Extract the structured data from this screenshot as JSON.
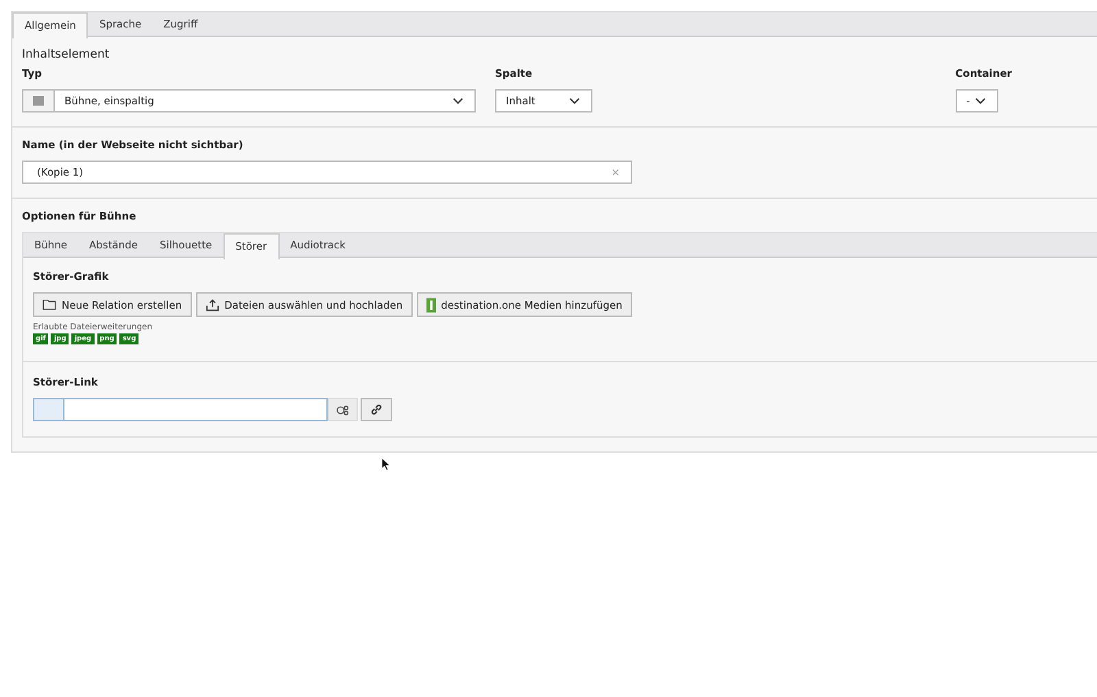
{
  "tabs": [
    {
      "label": "Allgemein",
      "selected": true
    },
    {
      "label": "Sprache",
      "selected": false
    },
    {
      "label": "Zugriff",
      "selected": false
    }
  ],
  "section_title": "Inhaltselement",
  "fields": {
    "typ": {
      "label": "Typ",
      "value": "Bühne, einspaltig"
    },
    "spalte": {
      "label": "Spalte",
      "value": "Inhalt"
    },
    "container": {
      "label": "Container",
      "value": "-"
    }
  },
  "name_field": {
    "label": "Name (in der Webseite nicht sichtbar)",
    "value": "(Kopie 1)",
    "clear": "×"
  },
  "options": {
    "title": "Optionen für Bühne",
    "tabs": [
      {
        "label": "Bühne",
        "selected": false
      },
      {
        "label": "Abstände",
        "selected": false
      },
      {
        "label": "Silhouette",
        "selected": false
      },
      {
        "label": "Störer",
        "selected": true
      },
      {
        "label": "Audiotrack",
        "selected": false
      }
    ],
    "grafik": {
      "title": "Störer-Grafik",
      "buttons": [
        {
          "label": "Neue Relation erstellen",
          "kind": "folder"
        },
        {
          "label": "Dateien auswählen und hochladen",
          "kind": "upload"
        },
        {
          "label": "destination.one Medien hinzufügen",
          "kind": "logo"
        }
      ],
      "extensions_label": "Erlaubte Dateierweiterungen",
      "extensions": [
        "gif",
        "jpg",
        "jpeg",
        "png",
        "svg"
      ]
    },
    "link": {
      "title": "Störer-Link"
    }
  }
}
